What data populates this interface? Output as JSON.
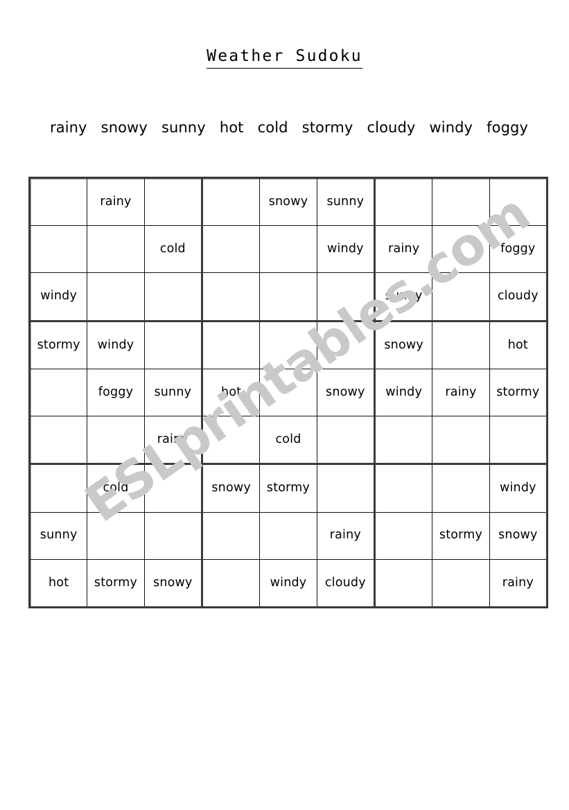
{
  "page": {
    "title": "Weather Sudoku",
    "watermark": "ESLprintables.com",
    "colors": {
      "ink": "#000000",
      "grid_thick": "#3a3a3a",
      "grid_thin": "#111111",
      "watermark": "#c9c9c9",
      "background": "#ffffff"
    }
  },
  "word_bank": {
    "words": [
      "rainy",
      "snowy",
      "sunny",
      "hot",
      "cold",
      "stormy",
      "cloudy",
      "windy",
      "foggy"
    ]
  },
  "sudoku": {
    "size": 9,
    "block_size": 3,
    "rows": [
      [
        "",
        "rainy",
        "",
        "",
        "snowy",
        "sunny",
        "",
        "",
        ""
      ],
      [
        "",
        "",
        "cold",
        "",
        "",
        "windy",
        "rainy",
        "",
        "foggy"
      ],
      [
        "windy",
        "",
        "",
        "",
        "",
        "",
        "sunny",
        "",
        "cloudy"
      ],
      [
        "stormy",
        "windy",
        "",
        "",
        "",
        "",
        "snowy",
        "",
        "hot"
      ],
      [
        "",
        "foggy",
        "sunny",
        "hot",
        "",
        "snowy",
        "windy",
        "rainy",
        "stormy"
      ],
      [
        "",
        "",
        "rainy",
        "",
        "cold",
        "",
        "",
        "",
        ""
      ],
      [
        "",
        "cold",
        "",
        "snowy",
        "stormy",
        "",
        "",
        "",
        "windy"
      ],
      [
        "sunny",
        "",
        "",
        "",
        "",
        "rainy",
        "",
        "stormy",
        "snowy"
      ],
      [
        "hot",
        "stormy",
        "snowy",
        "",
        "windy",
        "cloudy",
        "",
        "",
        "rainy"
      ]
    ]
  }
}
